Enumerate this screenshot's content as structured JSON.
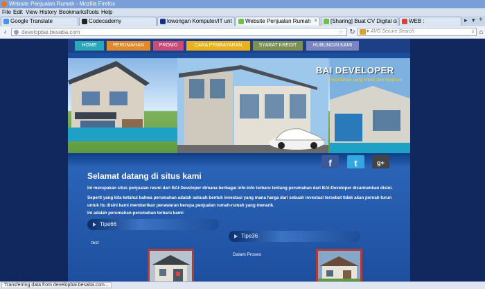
{
  "window": {
    "title": "Website Penjualan Rumah - Mozilla Firefox"
  },
  "menubar": [
    "File",
    "Edit",
    "View",
    "History",
    "Bookmarks",
    "Tools",
    "Help"
  ],
  "tabs": [
    {
      "label": "Google Translate",
      "icon_color": "#4a8ef0"
    },
    {
      "label": "Codecademy",
      "icon_color": "#222222"
    },
    {
      "label": "lowongan Komputer/IT untu...",
      "icon_color": "#1a2e8a"
    },
    {
      "label": "Website Penjualan Rumah",
      "icon_color": "#6fbf4a"
    },
    {
      "label": "[Sharing] Buat CV Digital dan ...",
      "icon_color": "#6fbf4a"
    },
    {
      "label": "WEB :",
      "icon_color": "#d8423a"
    }
  ],
  "address": {
    "url": "developbai.besaba.com"
  },
  "search": {
    "placeholder": "AVG Secure Search"
  },
  "site": {
    "menu": [
      {
        "label": "HOME",
        "color": "#2aa7b8"
      },
      {
        "label": "PERUMAHAN",
        "color": "#e08a2c"
      },
      {
        "label": "PROMO",
        "color": "#c84c78"
      },
      {
        "label": "CARA PEMBAYARAN",
        "color": "#e8b21e"
      },
      {
        "label": "SYARAT KREDIT",
        "color": "#7c8f55"
      },
      {
        "label": "HUBUNGIN KAMI",
        "color": "#7a86c0"
      }
    ],
    "banner_title": "BAI DEVELOPER",
    "banner_tagline": "Perumahan yang Indah dan Nyaman",
    "social": {
      "facebook": "f",
      "twitter": "t",
      "googleplus": "g+"
    },
    "welcome": "Selamat datang di situs kami",
    "para1": "ini merupakan situs penjualan resmi dari BAI-Developer dimana berbagai info-info terbaru tentang perumahan dari BAI-Developer dicantumkan disini.",
    "para2a": "Seperti yang kita ketahui bahwa perumahan adalah sebuah bentuk investasi yang mana harga dari sebuah investasi tersebut tidak akan pernah turun",
    "para2b": "untuk itu disini kami memberikan penawaran berupa penjualan rumah-rumah yang menarik.",
    "para3": "Ini adalah perumahan-perumahan terbaru kami:",
    "cards": [
      {
        "type": "Tipe66",
        "note": "test"
      },
      {
        "type": "Tipe36",
        "note": "Dalam Proses"
      }
    ]
  },
  "status": {
    "text": "Transferring data from developbai.besaba.com..."
  }
}
